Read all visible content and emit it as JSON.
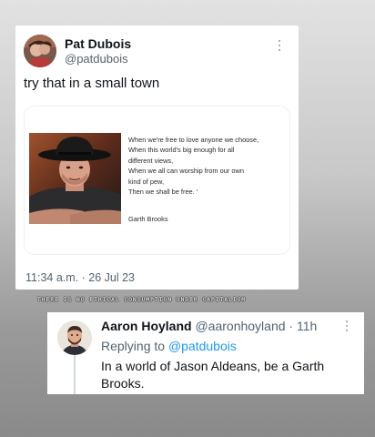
{
  "tweet": {
    "author_name": "Pat Dubois",
    "author_handle": "@patdubois",
    "text": "try that in a small town",
    "timestamp": "11:34 a.m. · 26 Jul 23",
    "quote_image": {
      "lines": [
        "When we're free to love anyone we choose,",
        "When this world's big enough for all",
        "different views,",
        "When we all can worship from our own",
        "kind of pew,",
        "Then we shall be free. '"
      ],
      "attribution": "Garth Brooks"
    }
  },
  "caption": "THERE IS NO ETHICAL CONSUMPTION UNDER CAPITALISM",
  "reply": {
    "author_name": "Aaron Hoyland",
    "author_handle": "@aaronhoyland",
    "separator": " · ",
    "time_ago": "11h",
    "replying_prefix": "Replying to ",
    "replying_handle": "@patdubois",
    "text": "In a world of Jason Aldeans, be a Garth Brooks."
  },
  "icons": {
    "more": "more-options-icon"
  },
  "colors": {
    "link": "#1d9bf0",
    "secondary_text": "#536471",
    "primary_text": "#0f1419"
  }
}
